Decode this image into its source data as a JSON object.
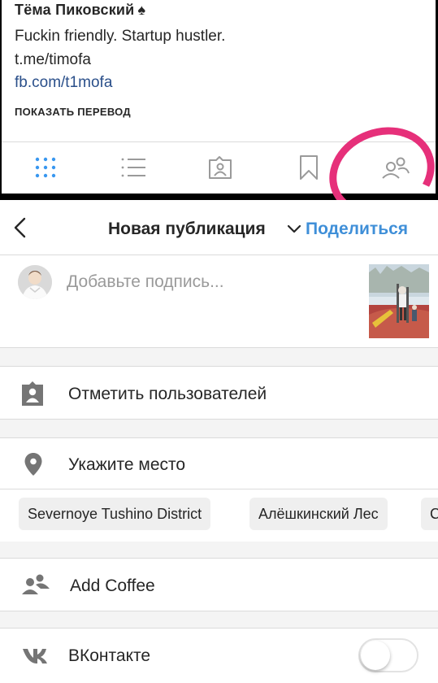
{
  "profile": {
    "name": "Тёма Пиковский",
    "name_suffix": "♠",
    "bio": "Fuckin friendly. Startup hustler.",
    "link_telegram": "t.me/timofa",
    "link_facebook": "fb.com/t1mofa",
    "translate_label": "ПОКАЗАТЬ ПЕРЕВОД",
    "tabs": [
      "grid-icon",
      "list-icon",
      "tagged-icon",
      "saved-icon",
      "following-icon"
    ],
    "accent_color": "#3897f0",
    "highlight_color": "#e6307a"
  },
  "header": {
    "back_icon": "chevron-left-icon",
    "title": "Новая публикация",
    "title_dropdown_icon": "chevron-down-icon",
    "share_label": "Поделиться",
    "share_color": "#3f8fd8"
  },
  "caption": {
    "placeholder": "Добавьте подпись...",
    "value": ""
  },
  "options": {
    "tag_people": {
      "icon": "tag-person-icon",
      "label": "Отметить пользователей"
    },
    "location": {
      "icon": "location-pin-icon",
      "label": "Укажите место"
    },
    "location_suggestions": [
      "Severnoye Tushino District",
      "Алёшкинский Лес",
      "С"
    ],
    "add_coffee": {
      "icon": "people-add-icon",
      "label": "Add Coffee"
    },
    "vk": {
      "icon": "vk-icon",
      "label": "ВКонтакте",
      "enabled": false
    }
  }
}
